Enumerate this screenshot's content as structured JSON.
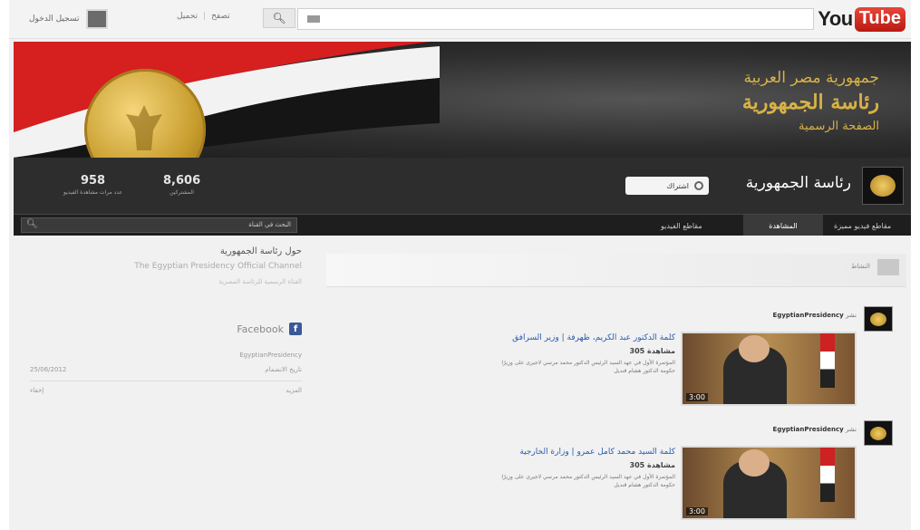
{
  "topbar": {
    "logo_you": "You",
    "logo_tube": "Tube",
    "signin_label": "تسجيل الدخول",
    "links": [
      "تصفح",
      "تحميل"
    ],
    "search_button_icon": "magnifier-icon"
  },
  "banner": {
    "line1": "جمهورية مصر العربية",
    "line2": "رئاسة الجمهورية",
    "line3": "الصفحة الرسمية"
  },
  "channel": {
    "name": "رئاسة الجمهورية",
    "subscribe_label": "اشتراك",
    "stats": [
      {
        "value": "958",
        "label": "عدد مرات مشاهدة الفيديو"
      },
      {
        "value": "8,606",
        "label": "المشتركين"
      }
    ]
  },
  "nav": {
    "search_placeholder": "البحث في القناة",
    "tabs": [
      "مقاطع فيديو مميزة",
      "المشاهدة",
      "مقاطع الفيديو"
    ]
  },
  "about": {
    "title": "حول رئاسة الجمهورية",
    "english": "The Egyptian Presidency Official Channel",
    "subtitle": "القناة الرسمية للرئاسة المصرية",
    "facebook_label": "Facebook",
    "username_row": "EgyptianPresidency",
    "joined_label": "تاريخ الانضمام",
    "joined_value": "25/06/2012",
    "more_label": "المزيد",
    "less_label": "إخفاء"
  },
  "feed": {
    "header_label": "النشاط"
  },
  "posts": [
    {
      "channel": "EgyptianPresidency",
      "prefix": "نشر",
      "title": "كلمة الدكتور عبد الكريم، ظهرفة | وزير السرافق",
      "views": "305 مشاهدة",
      "desc": "المؤتمرة الأول في عهد السيد الرئيس الدكتور محمد مرسي لاجيرى على وزيرًا حكومة الدكتور هشام قنديل",
      "duration": "3:00"
    },
    {
      "channel": "EgyptianPresidency",
      "prefix": "نشر",
      "title": "كلمة السيد محمد كامل عمرو | وزارة الخارجية",
      "views": "305 مشاهدة",
      "desc": "المؤتمرة الأول في عهد السيد الرئيس الدكتور محمد مرسي لاجيرى على وزيرًا حكومة الدكتور هشام قنديل",
      "duration": "3:00"
    }
  ]
}
